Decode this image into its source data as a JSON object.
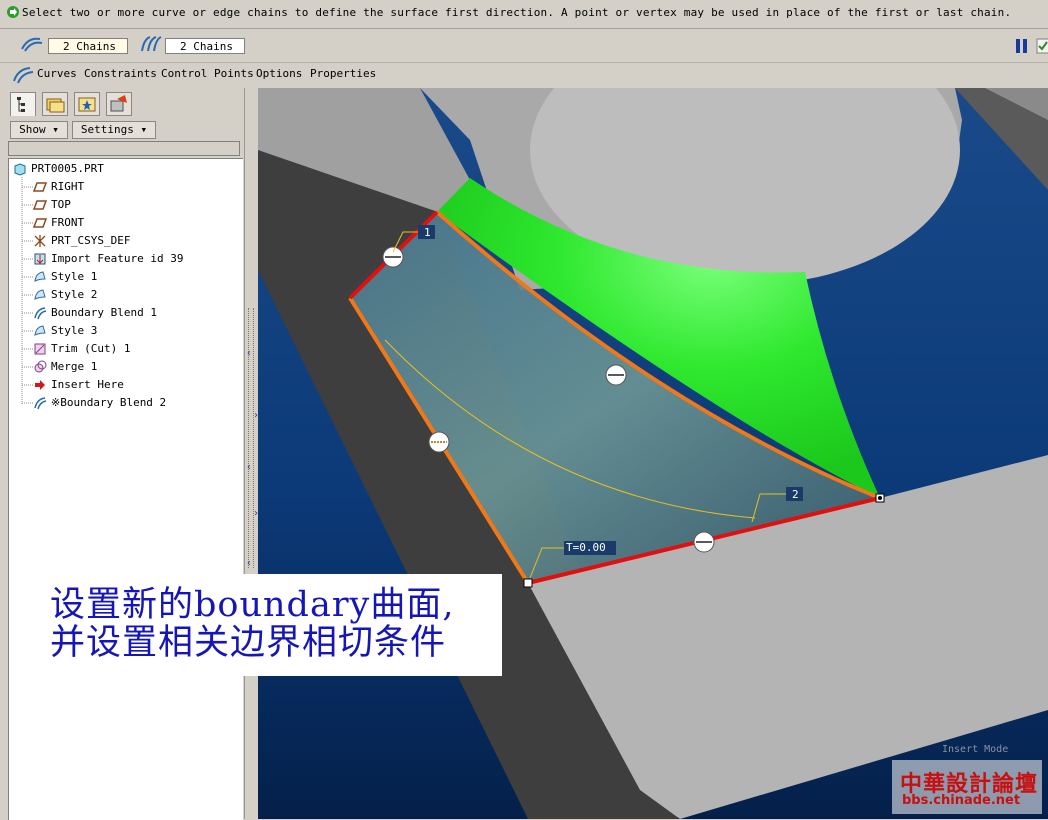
{
  "message": "Select two or more curve or edge chains to define the surface first direction. A point or vertex may be used in place of the first or last chain.",
  "dashboard": {
    "first_direction": "2 Chains",
    "second_direction": "2 Chains"
  },
  "slide_tabs": [
    "Curves",
    "Constraints",
    "Control Points",
    "Options",
    "Properties"
  ],
  "panel": {
    "show_label": "Show",
    "settings_label": "Settings"
  },
  "model_tree": {
    "root": "PRT0005.PRT",
    "items": [
      {
        "label": "RIGHT",
        "icon": "datum-plane-icon"
      },
      {
        "label": "TOP",
        "icon": "datum-plane-icon"
      },
      {
        "label": "FRONT",
        "icon": "datum-plane-icon"
      },
      {
        "label": "PRT_CSYS_DEF",
        "icon": "csys-icon"
      },
      {
        "label": "Import Feature id 39",
        "icon": "import-feature-icon"
      },
      {
        "label": "Style 1",
        "icon": "style-icon"
      },
      {
        "label": "Style 2",
        "icon": "style-icon"
      },
      {
        "label": "Boundary Blend 1",
        "icon": "boundary-blend-icon"
      },
      {
        "label": "Style 3",
        "icon": "style-icon"
      },
      {
        "label": "Trim (Cut) 1",
        "icon": "trim-icon"
      },
      {
        "label": "Merge 1",
        "icon": "merge-icon"
      },
      {
        "label": "Insert Here",
        "icon": "insert-here-arrow-icon"
      },
      {
        "label": "※Boundary Blend 2",
        "icon": "boundary-blend-icon"
      }
    ]
  },
  "viewport": {
    "chain_label_1": "1",
    "chain_label_2": "2",
    "tension_label": "T=0.00",
    "mode_text": "Insert Mode"
  },
  "caption": {
    "line1": "设置新的boundary曲面,",
    "line2": "并设置相关边界相切条件"
  },
  "watermark": {
    "line1": "中華設計論壇",
    "line2": "bbs.chinade.net"
  },
  "colors": {
    "ui_gray": "#d4d0c8",
    "viewport_blue": "#0a3a78",
    "surface_green": "#2de02d",
    "edge_red": "#e01010",
    "edge_orange": "#f07818",
    "caption_blue": "#1515b8"
  }
}
